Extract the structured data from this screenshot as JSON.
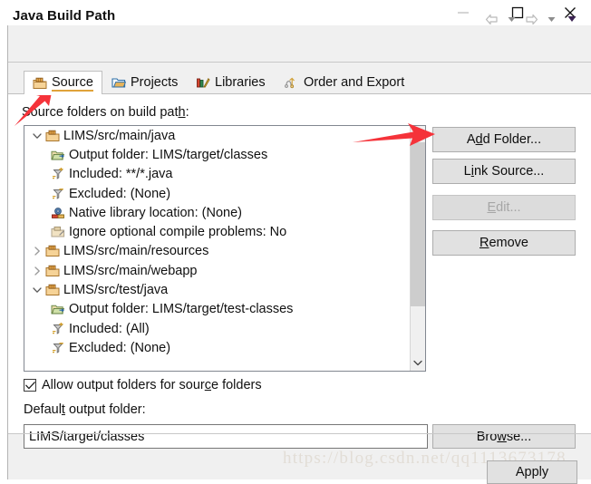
{
  "window": {
    "controls": [
      {
        "name": "minimize",
        "glyph": "minimize-icon"
      },
      {
        "name": "maximize",
        "glyph": "maximize-icon"
      },
      {
        "name": "close",
        "glyph": "close-icon"
      }
    ]
  },
  "header": {
    "title": "Java Build Path",
    "nav": [
      {
        "name": "back-arrow-icon"
      },
      {
        "name": "back-dropdown-icon"
      },
      {
        "name": "forward-arrow-icon"
      },
      {
        "name": "forward-dropdown-icon"
      },
      {
        "name": "menu-dropdown-icon"
      }
    ]
  },
  "tabs": [
    {
      "label": "Source",
      "icon": "source-folder-icon",
      "selected": true
    },
    {
      "label": "Projects",
      "icon": "projects-folder-icon",
      "selected": false
    },
    {
      "label": "Libraries",
      "icon": "libraries-books-icon",
      "selected": false
    },
    {
      "label": "Order and Export",
      "icon": "order-export-icon",
      "selected": false
    }
  ],
  "source_tab": {
    "tree_label_pre": "Source folders on build pat",
    "tree_label_mnemonic": "h",
    "tree_label_post": ":",
    "tree": [
      {
        "depth": 1,
        "twisty": "expanded",
        "icon": "source-folder-icon",
        "label": "LIMS/src/main/java"
      },
      {
        "depth": 2,
        "twisty": "none",
        "icon": "output-folder-icon",
        "label": "Output folder: LIMS/target/classes"
      },
      {
        "depth": 2,
        "twisty": "none",
        "icon": "included-filter-icon",
        "label": "Included: **/*.java"
      },
      {
        "depth": 2,
        "twisty": "none",
        "icon": "excluded-filter-icon",
        "label": "Excluded: (None)"
      },
      {
        "depth": 2,
        "twisty": "none",
        "icon": "native-library-icon",
        "label": "Native library location: (None)"
      },
      {
        "depth": 2,
        "twisty": "none",
        "icon": "ignore-problems-icon",
        "label": "Ignore optional compile problems: No"
      },
      {
        "depth": 1,
        "twisty": "collapsed",
        "icon": "source-folder-icon",
        "label": "LIMS/src/main/resources"
      },
      {
        "depth": 1,
        "twisty": "collapsed",
        "icon": "source-folder-icon",
        "label": "LIMS/src/main/webapp"
      },
      {
        "depth": 1,
        "twisty": "expanded",
        "icon": "source-folder-icon",
        "label": "LIMS/src/test/java"
      },
      {
        "depth": 2,
        "twisty": "none",
        "icon": "output-folder-icon",
        "label": "Output folder: LIMS/target/test-classes"
      },
      {
        "depth": 2,
        "twisty": "none",
        "icon": "included-filter-icon",
        "label": "Included: (All)"
      },
      {
        "depth": 2,
        "twisty": "none",
        "icon": "excluded-filter-icon",
        "label": "Excluded: (None)"
      }
    ],
    "buttons": {
      "add_folder": {
        "pre": "A",
        "mnemonic": "d",
        "post": "d Folder...",
        "enabled": true
      },
      "link_source": {
        "pre": "L",
        "mnemonic": "i",
        "post": "nk Source...",
        "enabled": true
      },
      "edit": {
        "pre": "",
        "mnemonic": "E",
        "post": "dit...",
        "enabled": false
      },
      "remove": {
        "pre": "",
        "mnemonic": "R",
        "post": "emove",
        "enabled": true
      }
    },
    "allow_output": {
      "checked": true,
      "pre": "Allow output folders for sour",
      "mnemonic": "c",
      "post": "e folders"
    },
    "default_output": {
      "label_pre": "Defaul",
      "label_mnemonic": "t",
      "label_post": " output folder:",
      "value": "LIMS/target/classes",
      "placeholder": ""
    },
    "browse_button": {
      "pre": "Bro",
      "mnemonic": "w",
      "post": "se..."
    }
  },
  "footer": {
    "apply_label": "Apply"
  },
  "watermark": "https://blog.csdn.net/qq1113673178",
  "colors": {
    "accent_tab_underline": "#e0a33a",
    "annotation_red": "#f5333a",
    "dialog_bg": "#f0f0f0",
    "content_bg": "#ffffff",
    "button_bg": "#e1e1e1",
    "scrollbar_thumb": "#cdcdcd"
  }
}
